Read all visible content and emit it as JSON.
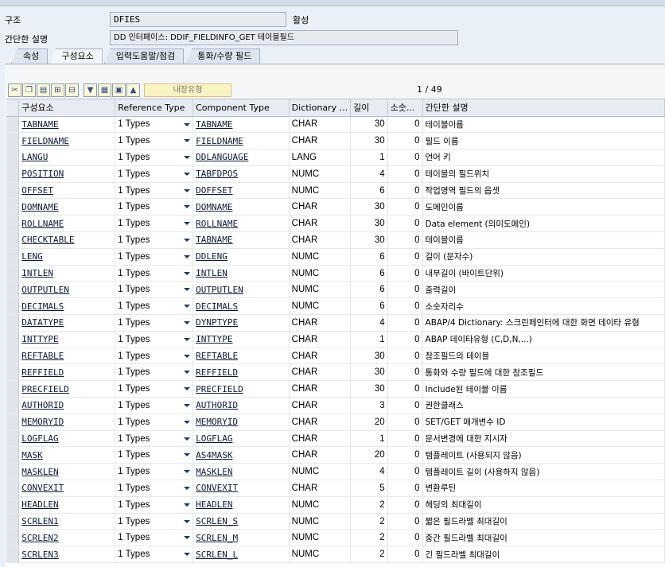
{
  "header": {
    "structure_label": "구조",
    "structure_value": "DFIES",
    "status": "활성",
    "desc_label": "간단한 설명",
    "desc_value": "DD 인터페이스: DDIF_FIELDINFO_GET 테이블필드"
  },
  "tabs": [
    "속성",
    "구성요소",
    "입력도움말/점검",
    "통화/수량 필드"
  ],
  "active_tab": 1,
  "toolbar": {
    "builtin_type_label": "내장유형",
    "pager": "1 / 49"
  },
  "columns": [
    "구성요소",
    "Reference Type",
    "Component Type",
    "Dictionary ...",
    "길이",
    "소숫...",
    "간단한 설명"
  ],
  "rows": [
    {
      "name": "TABNAME",
      "ref": "1 Types",
      "comp": "TABNAME",
      "dict": "CHAR",
      "len": "30",
      "dec": "0",
      "desc": "테이블이름"
    },
    {
      "name": "FIELDNAME",
      "ref": "1 Types",
      "comp": "FIELDNAME",
      "dict": "CHAR",
      "len": "30",
      "dec": "0",
      "desc": "필드 이름"
    },
    {
      "name": "LANGU",
      "ref": "1 Types",
      "comp": "DDLANGUAGE",
      "dict": "LANG",
      "len": "1",
      "dec": "0",
      "desc": "언어 키"
    },
    {
      "name": "POSITION",
      "ref": "1 Types",
      "comp": "TABFDPOS",
      "dict": "NUMC",
      "len": "4",
      "dec": "0",
      "desc": "테이블의 필드위치"
    },
    {
      "name": "OFFSET",
      "ref": "1 Types",
      "comp": "DOFFSET",
      "dict": "NUMC",
      "len": "6",
      "dec": "0",
      "desc": "작업영역 필드의 옵셋"
    },
    {
      "name": "DOMNAME",
      "ref": "1 Types",
      "comp": "DOMNAME",
      "dict": "CHAR",
      "len": "30",
      "dec": "0",
      "desc": "도메인이름"
    },
    {
      "name": "ROLLNAME",
      "ref": "1 Types",
      "comp": "ROLLNAME",
      "dict": "CHAR",
      "len": "30",
      "dec": "0",
      "desc": "Data element (의미도메인)"
    },
    {
      "name": "CHECKTABLE",
      "ref": "1 Types",
      "comp": "TABNAME",
      "dict": "CHAR",
      "len": "30",
      "dec": "0",
      "desc": "테이블이름"
    },
    {
      "name": "LENG",
      "ref": "1 Types",
      "comp": "DDLENG",
      "dict": "NUMC",
      "len": "6",
      "dec": "0",
      "desc": "길이 (문자수)"
    },
    {
      "name": "INTLEN",
      "ref": "1 Types",
      "comp": "INTLEN",
      "dict": "NUMC",
      "len": "6",
      "dec": "0",
      "desc": "내부길이 (바이트단위)"
    },
    {
      "name": "OUTPUTLEN",
      "ref": "1 Types",
      "comp": "OUTPUTLEN",
      "dict": "NUMC",
      "len": "6",
      "dec": "0",
      "desc": "출력길이"
    },
    {
      "name": "DECIMALS",
      "ref": "1 Types",
      "comp": "DECIMALS",
      "dict": "NUMC",
      "len": "6",
      "dec": "0",
      "desc": "소숫자리수"
    },
    {
      "name": "DATATYPE",
      "ref": "1 Types",
      "comp": "DYNPTYPE",
      "dict": "CHAR",
      "len": "4",
      "dec": "0",
      "desc": "ABAP/4 Dictionary: 스크린페인터에 대한 화면 데이타 유형"
    },
    {
      "name": "INTTYPE",
      "ref": "1 Types",
      "comp": "INTTYPE",
      "dict": "CHAR",
      "len": "1",
      "dec": "0",
      "desc": "ABAP 데이타유형 (C,D,N,...)"
    },
    {
      "name": "REFTABLE",
      "ref": "1 Types",
      "comp": "REFTABLE",
      "dict": "CHAR",
      "len": "30",
      "dec": "0",
      "desc": "참조필드의 테이블"
    },
    {
      "name": "REFFIELD",
      "ref": "1 Types",
      "comp": "REFFIELD",
      "dict": "CHAR",
      "len": "30",
      "dec": "0",
      "desc": "통화와 수량 필드에 대한 참조필드"
    },
    {
      "name": "PRECFIELD",
      "ref": "1 Types",
      "comp": "PRECFIELD",
      "dict": "CHAR",
      "len": "30",
      "dec": "0",
      "desc": "Include된 테이블 이름"
    },
    {
      "name": "AUTHORID",
      "ref": "1 Types",
      "comp": "AUTHORID",
      "dict": "CHAR",
      "len": "3",
      "dec": "0",
      "desc": "권한클래스"
    },
    {
      "name": "MEMORYID",
      "ref": "1 Types",
      "comp": "MEMORYID",
      "dict": "CHAR",
      "len": "20",
      "dec": "0",
      "desc": "SET/GET 매개변수 ID"
    },
    {
      "name": "LOGFLAG",
      "ref": "1 Types",
      "comp": "LOGFLAG",
      "dict": "CHAR",
      "len": "1",
      "dec": "0",
      "desc": "문서변경에 대한 지시자"
    },
    {
      "name": "MASK",
      "ref": "1 Types",
      "comp": "AS4MASK",
      "dict": "CHAR",
      "len": "20",
      "dec": "0",
      "desc": "템플레이트 (사용되지 않음)"
    },
    {
      "name": "MASKLEN",
      "ref": "1 Types",
      "comp": "MASKLEN",
      "dict": "NUMC",
      "len": "4",
      "dec": "0",
      "desc": "템플레이트 길이 (사용하지 않음)"
    },
    {
      "name": "CONVEXIT",
      "ref": "1 Types",
      "comp": "CONVEXIT",
      "dict": "CHAR",
      "len": "5",
      "dec": "0",
      "desc": "변환루틴"
    },
    {
      "name": "HEADLEN",
      "ref": "1 Types",
      "comp": "HEADLEN",
      "dict": "NUMC",
      "len": "2",
      "dec": "0",
      "desc": "헤딩의 최대길이"
    },
    {
      "name": "SCRLEN1",
      "ref": "1 Types",
      "comp": "SCRLEN_S",
      "dict": "NUMC",
      "len": "2",
      "dec": "0",
      "desc": "짧은 필드라벨 최대길이"
    },
    {
      "name": "SCRLEN2",
      "ref": "1 Types",
      "comp": "SCRLEN_M",
      "dict": "NUMC",
      "len": "2",
      "dec": "0",
      "desc": "중간 필드라벨 최대길이"
    },
    {
      "name": "SCRLEN3",
      "ref": "1 Types",
      "comp": "SCRLEN_L",
      "dict": "NUMC",
      "len": "2",
      "dec": "0",
      "desc": "긴 필드라벨 최대길이"
    }
  ]
}
